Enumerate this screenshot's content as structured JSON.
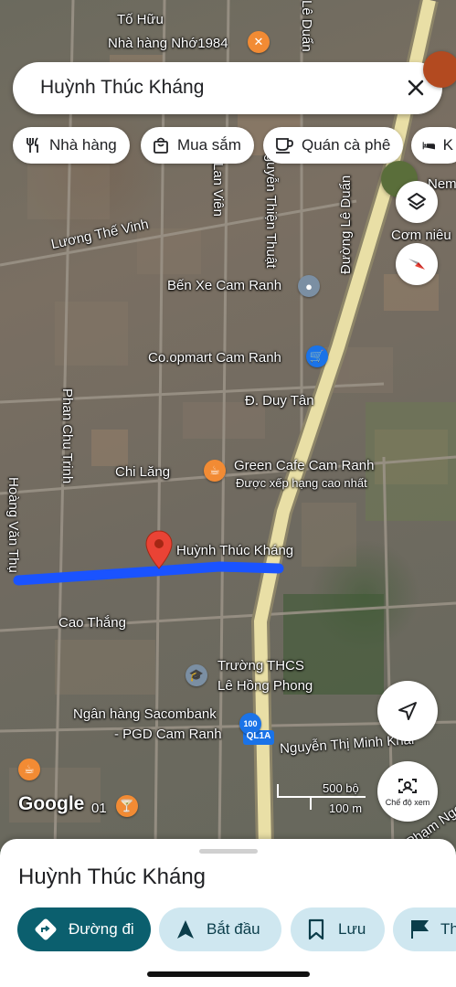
{
  "search": {
    "query": "Huỳnh Thúc Kháng"
  },
  "chips": [
    {
      "label": "Nhà hàng",
      "icon": "fork-knife-icon"
    },
    {
      "label": "Mua sắm",
      "icon": "shopping-bag-icon"
    },
    {
      "label": "Quán cà phê",
      "icon": "coffee-cup-icon"
    },
    {
      "label": "K",
      "icon": "bed-icon"
    }
  ],
  "map": {
    "labels": {
      "to_huu": "Tố Hữu",
      "nha_hang_nho": "Nhà hàng Nhớ1984",
      "le_duan_top": "Lê Duẩn",
      "lan_vien": "Lan Viên",
      "huyen_thien_thuat": "Nguyễn Thiện Thuật",
      "duong_le_duan": "Đường Lê Duẩn",
      "nem": "Nem",
      "com_nieu": "Cơm niêu",
      "luong_the_vinh": "Lương Thế Vinh",
      "ben_xe": "Bến Xe Cam Ranh",
      "coopmart": "Co.opmart Cam Ranh",
      "duy_tan": "Đ. Duy Tân",
      "phan_chu_trinh": "Phan Chu Trinh",
      "chi_lang": "Chi Lăng",
      "green_cafe": "Green Cafe Cam Ranh",
      "xep_hang": "Được xếp hạng cao nhất",
      "hoang_van_thu": "Hoàng Văn Thụ",
      "huynh_thuc_khang": "Huỳnh Thúc Kháng",
      "cao_thang": "Cao Thắng",
      "truong_thcs_1": "Trường THCS",
      "truong_thcs_2": "Lê Hồng Phong",
      "sacombank_1": "Ngân hàng Sacombank",
      "sacombank_2": "- PGD Cam Ranh",
      "minh_khai": "Nguyễn Thị Minh Khai",
      "ql1a": "QL1A",
      "pham_ngoc": "Phạm Ngọ",
      "road_100": "100",
      "scale_500": "500 bộ",
      "scale_100": "100 m",
      "google": "Google",
      "google_suffix": "01",
      "street_view": "Chế độ xem"
    },
    "colors": {
      "route": "#1a53ff",
      "pin": "#ea4335",
      "highway": "#e9dfa6",
      "accent": "#1a73e8"
    }
  },
  "sheet": {
    "title": "Huỳnh Thúc Kháng",
    "actions": [
      {
        "label": "Đường đi",
        "icon": "directions-icon"
      },
      {
        "label": "Bắt đầu",
        "icon": "navigation-arrow-icon"
      },
      {
        "label": "Lưu",
        "icon": "bookmark-icon"
      },
      {
        "label": "Th",
        "icon": "flag-icon"
      }
    ]
  }
}
